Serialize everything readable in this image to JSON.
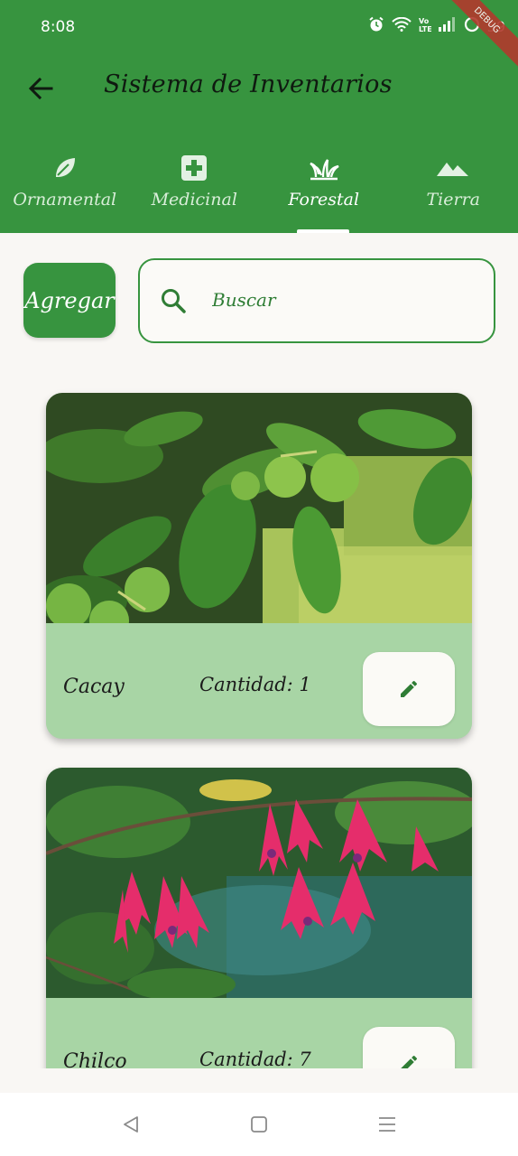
{
  "status_bar": {
    "time": "8:08",
    "battery": "59",
    "ribbon": "DEBUG"
  },
  "app_bar": {
    "title": "Sistema de Inventarios"
  },
  "tabs": [
    {
      "label": "Ornamental",
      "icon": "leaf-icon",
      "active": false
    },
    {
      "label": "Medicinal",
      "icon": "medical-cross-icon",
      "active": false
    },
    {
      "label": "Forestal",
      "icon": "grass-icon",
      "active": true
    },
    {
      "label": "Tierra",
      "icon": "mountain-icon",
      "active": false
    }
  ],
  "actions": {
    "add_label": "Agregar",
    "search_placeholder": "Buscar"
  },
  "items": [
    {
      "name": "Cacay",
      "quantity_text": "Cantidad: 1"
    },
    {
      "name": "Chilco",
      "quantity_text": "Cantidad: 7"
    }
  ],
  "colors": {
    "primary": "#37943f",
    "card_footer": "#a8d5a5",
    "background": "#f9f7f4"
  }
}
